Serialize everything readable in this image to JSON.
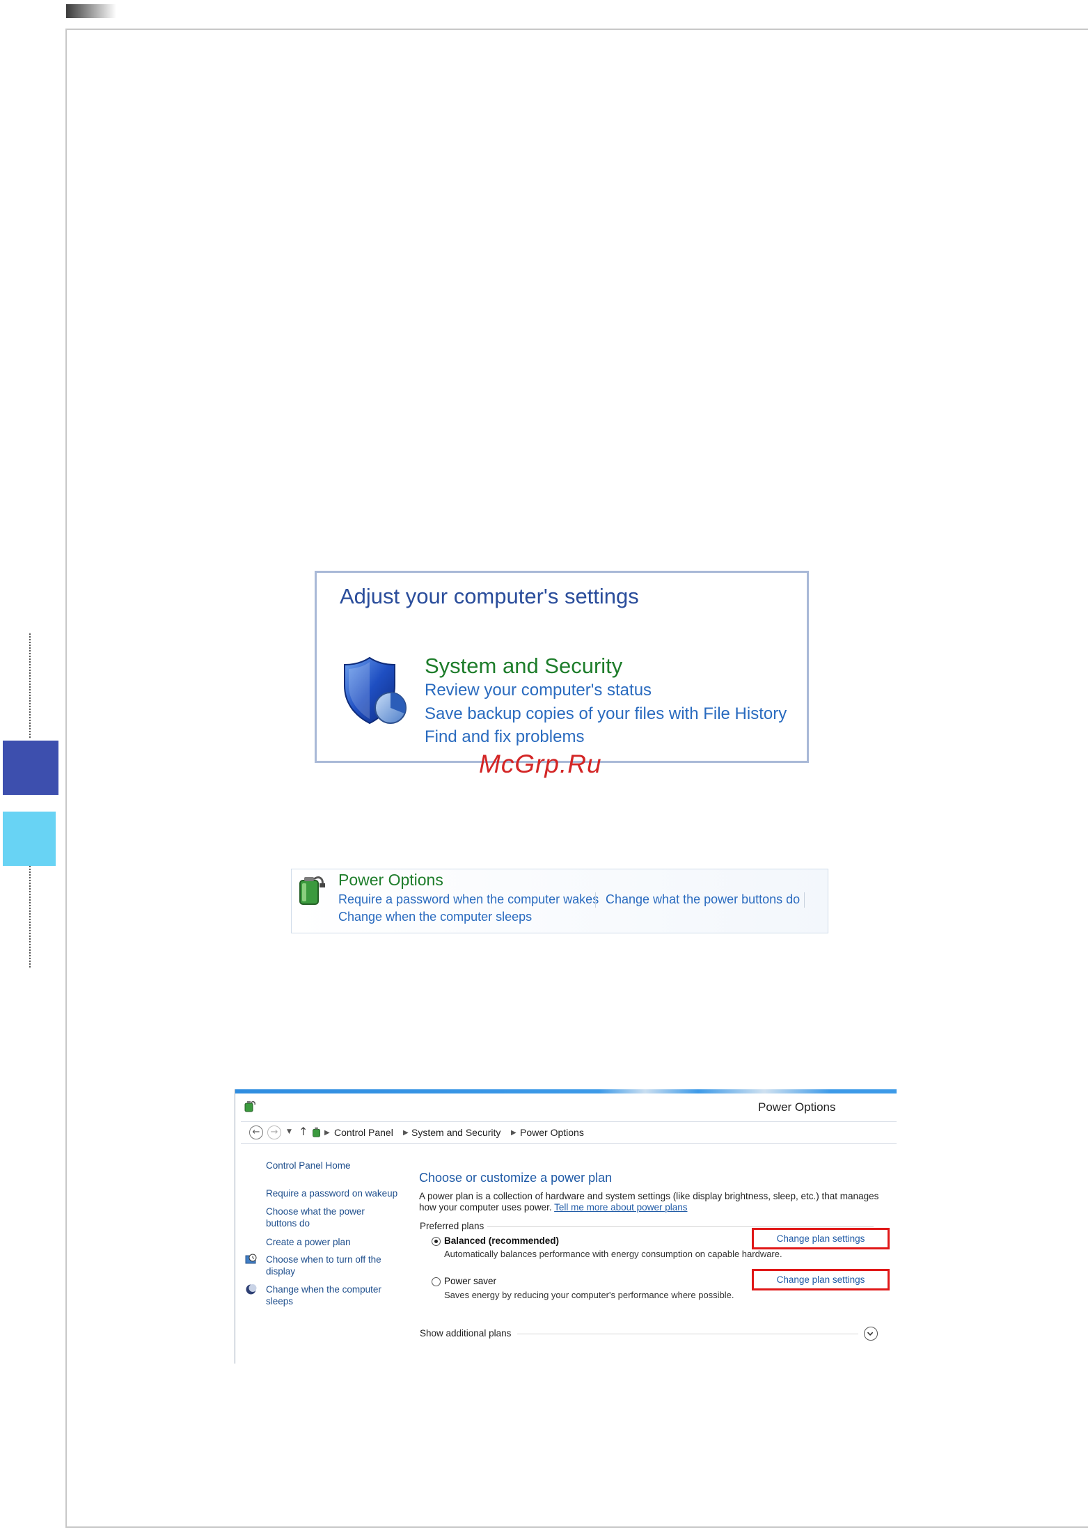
{
  "figure_settings": {
    "title": "Adjust your computer's settings",
    "category_link": "System and Security",
    "links": [
      "Review your computer's status",
      "Save backup copies of your files with File History",
      "Find and fix problems"
    ]
  },
  "watermark": "McGrp.Ru",
  "figure_power": {
    "title": "Power Options",
    "links": [
      "Require a password when the computer wakes",
      "Change what the power buttons do",
      "Change when the computer sleeps"
    ]
  },
  "window": {
    "title": "Power Options",
    "breadcrumb": [
      "Control Panel",
      "System and Security",
      "Power Options"
    ],
    "sidebar": {
      "items": [
        "Control Panel Home",
        "Require a password on wakeup",
        "Choose what the power buttons do",
        "Create a power plan",
        "Choose when to turn off the display",
        "Change when the computer sleeps"
      ]
    },
    "main": {
      "heading": "Choose or customize a power plan",
      "description_line1": "A power plan is a collection of hardware and system settings (like display brightness, sleep, etc.) that manages",
      "description_line2": "how your computer uses power.",
      "learn_more_link": "Tell me more about power plans",
      "preferred_plans_label": "Preferred plans",
      "plans": [
        {
          "name": "Balanced (recommended)",
          "description": "Automatically balances performance with energy consumption on capable hardware.",
          "selected": true,
          "action": "Change plan settings"
        },
        {
          "name": "Power saver",
          "description": "Saves energy by reducing your computer's performance where possible.",
          "selected": false,
          "action": "Change plan settings"
        }
      ],
      "additional_plans_label": "Show additional plans"
    }
  },
  "colors": {
    "accent_blue": "#2a6bbf",
    "category_green": "#1e7d2b",
    "highlight_red": "#e01818",
    "side_tab_dark": "#3d4fae",
    "side_tab_light": "#68d3f4"
  }
}
